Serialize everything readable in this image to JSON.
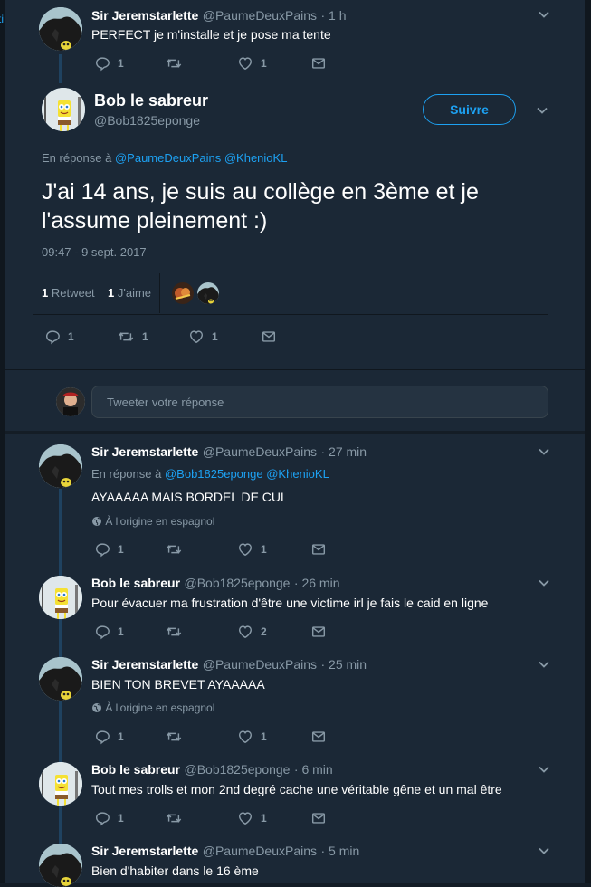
{
  "edge_fragment": "ti",
  "tweets": [
    {
      "name": "Sir Jeremstarlette",
      "handle": "@PaumeDeuxPains",
      "time": "· 1 h",
      "text": "PERFECT je m'installe et je pose ma tente",
      "reply": "1",
      "retweet": "",
      "like": "1"
    }
  ],
  "focused": {
    "name": "Bob le sabreur",
    "handle": "@Bob1825eponge",
    "follow_label": "Suivre",
    "reply_prefix": "En réponse à",
    "reply_mention_1": "@PaumeDeuxPains",
    "reply_mention_2": "@KhenioKL",
    "text": "J'ai 14 ans, je suis au collège en 3ème et je l'assume pleinement :)",
    "timestamp": "09:47 - 9 sept. 2017",
    "retweets_count": "1",
    "retweets_label": "Retweet",
    "likes_count": "1",
    "likes_label": "J'aime",
    "reply": "1",
    "retweet": "1",
    "like": "1"
  },
  "reply_box": {
    "placeholder": "Tweeter votre réponse"
  },
  "replies": [
    {
      "name": "Sir Jeremstarlette",
      "handle": "@PaumeDeuxPains",
      "time": "· 27 min",
      "reply_prefix": "En réponse à",
      "reply_mention_1": "@Bob1825eponge",
      "reply_mention_2": "@KhenioKL",
      "text": "AYAAAAA MAIS BORDEL DE CUL",
      "translate": "À l'origine en espagnol",
      "reply": "1",
      "retweet": "",
      "like": "1"
    },
    {
      "name": "Bob le sabreur",
      "handle": "@Bob1825eponge",
      "time": "· 26 min",
      "text": "Pour évacuer ma frustration d'être une victime irl je fais le caid en ligne",
      "reply": "1",
      "retweet": "",
      "like": "2"
    },
    {
      "name": "Sir Jeremstarlette",
      "handle": "@PaumeDeuxPains",
      "time": "· 25 min",
      "text": "BIEN TON BREVET AYAAAAA",
      "translate": "À l'origine en espagnol",
      "reply": "1",
      "retweet": "",
      "like": "1"
    },
    {
      "name": "Bob le sabreur",
      "handle": "@Bob1825eponge",
      "time": "· 6 min",
      "text": "Tout mes trolls et mon 2nd degré cache une véritable gêne et un mal être",
      "reply": "1",
      "retweet": "",
      "like": "1"
    },
    {
      "name": "Sir Jeremstarlette",
      "handle": "@PaumeDeuxPains",
      "time": "· 5 min",
      "text": "Bien d'habiter dans le 16 ème"
    }
  ],
  "colors": {
    "background": "#141d26",
    "card": "#1b2836",
    "accent": "#1da1f2",
    "muted": "#8899a6"
  }
}
